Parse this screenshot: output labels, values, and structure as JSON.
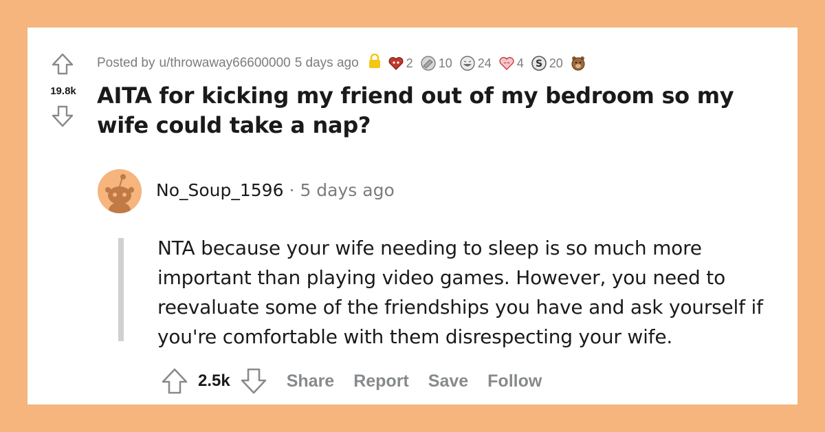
{
  "post": {
    "score": "19.8k",
    "posted_by_prefix": "Posted by",
    "author": "u/throwaway66600000",
    "time": "5 days ago",
    "awards": [
      {
        "icon": "heart-eyes-award-icon",
        "count": "2",
        "color": "#c0392b"
      },
      {
        "icon": "facepalm-award-icon",
        "count": "10",
        "color": "#9a9a9a"
      },
      {
        "icon": "laughing-award-icon",
        "count": "24",
        "color": "#8a8a8a"
      },
      {
        "icon": "wholesome-heart-award-icon",
        "count": "4",
        "color": "#e87a8f"
      },
      {
        "icon": "silver-award-icon",
        "count": "20",
        "color": "#7a7a7a"
      },
      {
        "icon": "bear-award-icon",
        "count": "",
        "color": "#8b5a2b"
      }
    ],
    "title": "AITA for kicking my friend out of my bedroom so my wife could take a nap?"
  },
  "comment": {
    "author": "No_Soup_1596",
    "separator": "·",
    "time": "5 days ago",
    "body": "NTA because your wife needing to sleep is so much more important than playing video games. However, you need to reevaluate some of the friendships you have and ask yourself if you're comfortable with them disrespecting your wife.",
    "score": "2.5k",
    "actions": {
      "share": "Share",
      "report": "Report",
      "save": "Save",
      "follow": "Follow"
    }
  },
  "colors": {
    "background": "#f5b57d",
    "card": "#ffffff",
    "meta_text": "#7c7c7c",
    "action_text": "#878a8c",
    "lock": "#f5c518"
  }
}
